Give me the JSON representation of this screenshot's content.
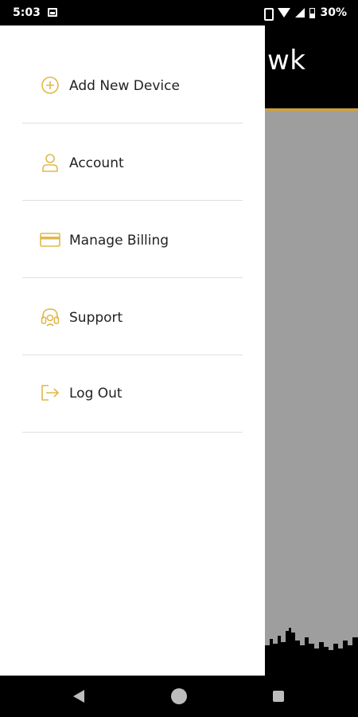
{
  "status_bar": {
    "time": "5:03",
    "battery_percent": "30%"
  },
  "app": {
    "title_partial": "wk",
    "accent_color": "#c9a047"
  },
  "drawer": {
    "items": [
      {
        "label": "Add New Device",
        "icon": "add-circle-icon"
      },
      {
        "label": "Account",
        "icon": "person-icon"
      },
      {
        "label": "Manage Billing",
        "icon": "credit-card-icon"
      },
      {
        "label": "Support",
        "icon": "headset-icon"
      },
      {
        "label": "Log Out",
        "icon": "logout-icon"
      }
    ]
  },
  "nav_bar": {
    "buttons": [
      "back",
      "home",
      "recents"
    ]
  }
}
